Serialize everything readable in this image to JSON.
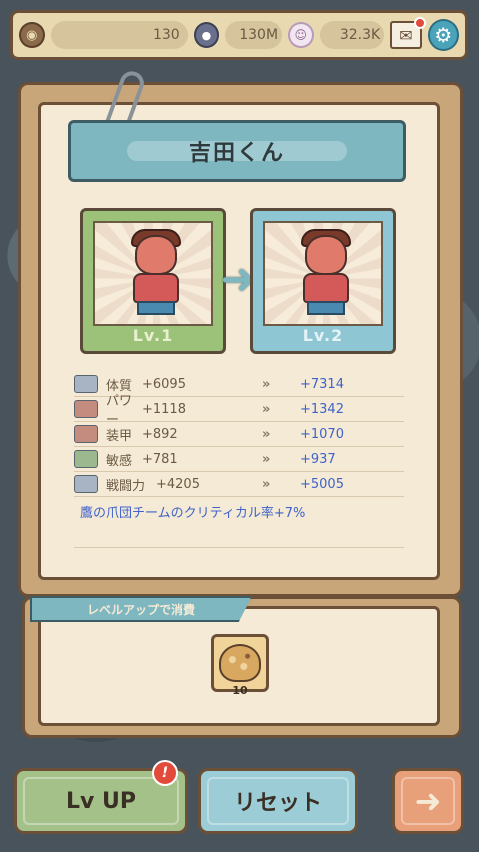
{
  "topbar": {
    "food_count": "130",
    "coin_count": "130M",
    "ghost_count": "32.3K",
    "icons": [
      "food-bag-icon",
      "coin-icon",
      "ghost-icon",
      "mail-icon",
      "gear-icon"
    ]
  },
  "character": {
    "name": "吉田くん",
    "current_level": "Lv.1",
    "next_level": "Lv.2"
  },
  "stats": [
    {
      "name": "体質",
      "current": "+6095",
      "next": "+7314"
    },
    {
      "name": "パワー",
      "current": "+1118",
      "next": "+1342"
    },
    {
      "name": "装甲",
      "current": "+892",
      "next": "+1070"
    },
    {
      "name": "敏感",
      "current": "+781",
      "next": "+937"
    },
    {
      "name": "戦闘力",
      "current": "+4205",
      "next": "+5005"
    }
  ],
  "skill": "鷹の爪団チームのクリティカル率+7%",
  "consume": {
    "tab_label": "レベルアップで消費",
    "item_count": "10"
  },
  "buttons": {
    "lvup": "Lv UP",
    "reset": "リセット",
    "alert": "!"
  },
  "colors": {
    "accent_teal": "#7fb7c0",
    "frame_brown": "#6b4f36",
    "stat_blue": "#3f63c9",
    "alert_red": "#e24a3b"
  }
}
